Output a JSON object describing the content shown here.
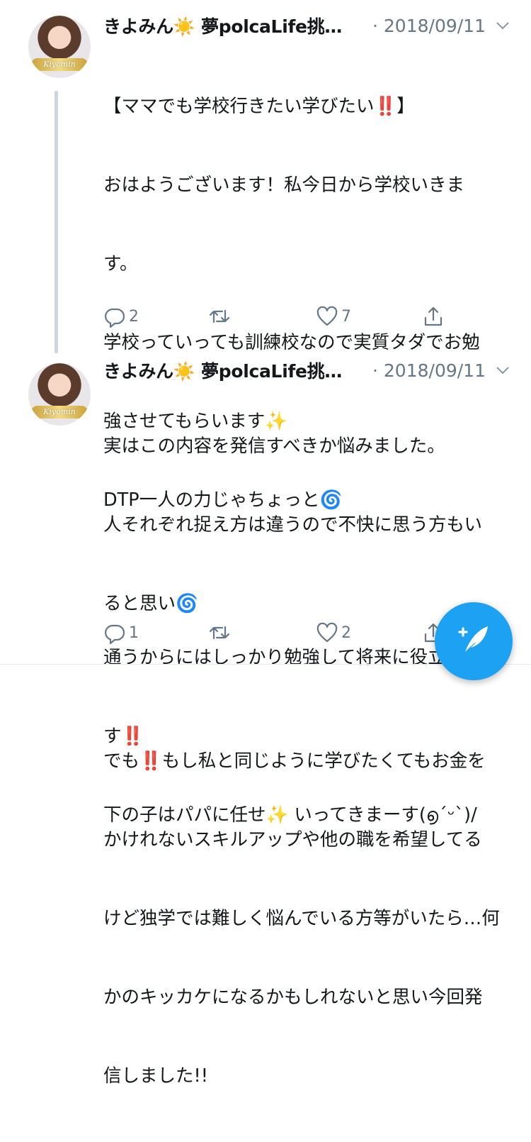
{
  "tweets": [
    {
      "author": "きよみん☀️ 夢polcaLife挑…",
      "avatar_label": "Kiyomin",
      "date": "· 2018/09/11",
      "lines": [
        "【ママでも学校行きたい学びたい‼️】",
        "おはようございます！私今日から学校いきま",
        "す。",
        "学校っていっても訓練校なので実質タダでお勉",
        "強させてもらいます✨",
        "DTP一人の力じゃちょっと🌀",
        "",
        "通うからにはしっかり勉強して将来に役立てま",
        "す‼️",
        "下の子はパパに任せ✨ いってきまーす(൭ˊᵕˋ)/"
      ],
      "replies": "2",
      "retweets": "",
      "likes": "7"
    },
    {
      "author": "きよみん☀️ 夢polcaLife挑…",
      "avatar_label": "Kiyomin",
      "date": "· 2018/09/11",
      "lines": [
        "実はこの内容を発信すべきか悩みました。",
        "人それぞれ捉え方は違うので不快に思う方もい",
        "ると思い🌀",
        "",
        "でも‼️もし私と同じように学びたくてもお金を",
        "かけれないスキルアップや他の職を希望してる",
        "けど独学では難しく悩んでいる方等がいたら…何",
        "かのキッカケになるかもしれないと思い今回発",
        "信しました!!"
      ],
      "replies": "1",
      "retweets": "",
      "likes": "2"
    }
  ],
  "icons": {
    "reply": "reply-icon",
    "retweet": "retweet-icon",
    "like": "heart-icon",
    "share": "share-icon",
    "caret": "chevron-down-icon",
    "compose": "compose-tweet-icon"
  },
  "colors": {
    "accent": "#1da1f2",
    "secondary_text": "#657786",
    "thread_line": "#ccd6dd"
  }
}
